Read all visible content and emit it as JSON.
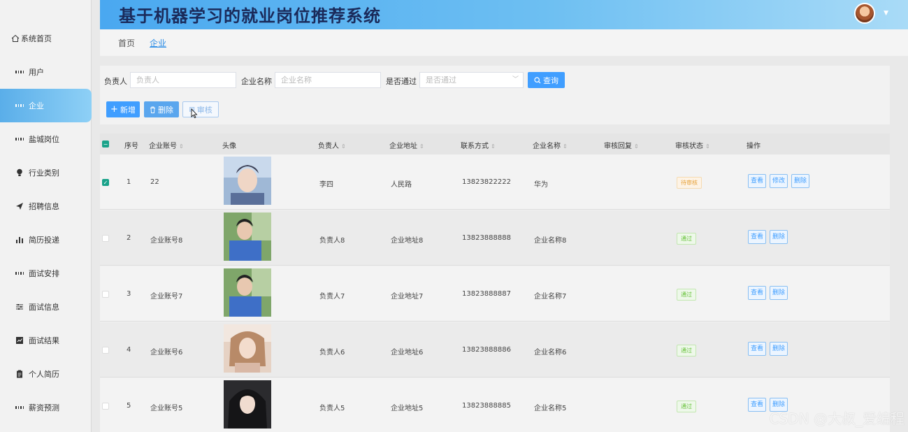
{
  "app_title": "基于机器学习的就业岗位推荐系统",
  "sidebar": {
    "items": [
      {
        "label": "系统首页",
        "icon": "home-icon"
      },
      {
        "label": "用户",
        "icon": "grid-icon"
      },
      {
        "label": "企业",
        "icon": "grid-icon",
        "active": true
      },
      {
        "label": "盐城岗位",
        "icon": "grid-icon"
      },
      {
        "label": "行业类别",
        "icon": "bulb-icon"
      },
      {
        "label": "招聘信息",
        "icon": "send-icon"
      },
      {
        "label": "简历投递",
        "icon": "bar-chart-icon"
      },
      {
        "label": "面试安排",
        "icon": "grid-icon"
      },
      {
        "label": "面试信息",
        "icon": "sliders-icon"
      },
      {
        "label": "面试结果",
        "icon": "chart-box-icon"
      },
      {
        "label": "个人简历",
        "icon": "clipboard-icon"
      },
      {
        "label": "薪资预测",
        "icon": "grid-icon"
      }
    ]
  },
  "breadcrumb": {
    "home": "首页",
    "current": "企业"
  },
  "filters": {
    "owner_label": "负责人",
    "owner_placeholder": "负责人",
    "company_label": "企业名称",
    "company_placeholder": "企业名称",
    "passed_label": "是否通过",
    "passed_placeholder": "是否通过",
    "search_button": "查询"
  },
  "toolbar": {
    "add": "新增",
    "delete": "删除",
    "review": "审核"
  },
  "table": {
    "headers": [
      "序号",
      "企业账号",
      "头像",
      "负责人",
      "企业地址",
      "联系方式",
      "企业名称",
      "审核回复",
      "审核状态",
      "操作"
    ],
    "rows": [
      {
        "index": "1",
        "account": "22",
        "owner": "李四",
        "address": "人民路",
        "phone": "13823822222",
        "name": "华为",
        "reply": "",
        "status": "待审核",
        "status_type": "pending",
        "actions": [
          "查看",
          "修改",
          "删除"
        ],
        "checked": true
      },
      {
        "index": "2",
        "account": "企业账号8",
        "owner": "负责人8",
        "address": "企业地址8",
        "phone": "13823888888",
        "name": "企业名称8",
        "reply": "",
        "status": "通过",
        "status_type": "pass",
        "actions": [
          "查看",
          "删除"
        ],
        "checked": false
      },
      {
        "index": "3",
        "account": "企业账号7",
        "owner": "负责人7",
        "address": "企业地址7",
        "phone": "13823888887",
        "name": "企业名称7",
        "reply": "",
        "status": "通过",
        "status_type": "pass",
        "actions": [
          "查看",
          "删除"
        ],
        "checked": false
      },
      {
        "index": "4",
        "account": "企业账号6",
        "owner": "负责人6",
        "address": "企业地址6",
        "phone": "13823888886",
        "name": "企业名称6",
        "reply": "",
        "status": "通过",
        "status_type": "pass",
        "actions": [
          "查看",
          "删除"
        ],
        "checked": false
      },
      {
        "index": "5",
        "account": "企业账号5",
        "owner": "负责人5",
        "address": "企业地址5",
        "phone": "13823888885",
        "name": "企业名称5",
        "reply": "",
        "status": "通过",
        "status_type": "pass",
        "actions": [
          "查看",
          "删除"
        ],
        "checked": false
      }
    ]
  },
  "watermark": "CSDN @大叔_爱编程"
}
